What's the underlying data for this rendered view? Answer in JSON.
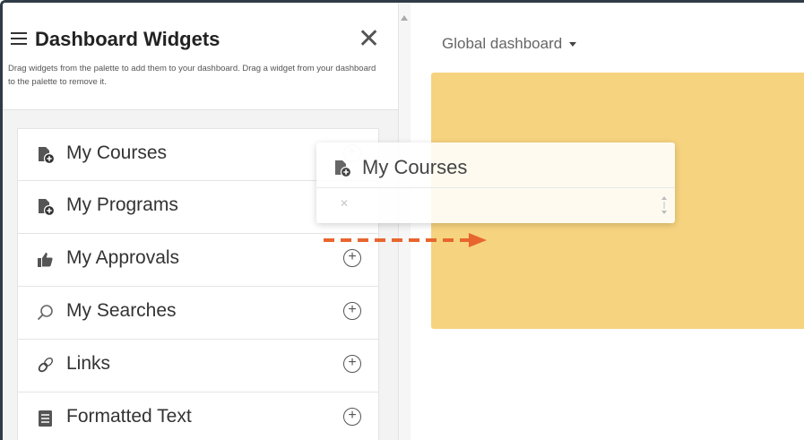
{
  "sidebar": {
    "title": "Dashboard Widgets",
    "description": "Drag widgets from the palette to add them to your dashboard. Drag a widget from your dashboard to the palette to remove it.",
    "close_symbol": "✕",
    "add_symbol": "+",
    "items": [
      {
        "label": "My Courses",
        "icon": "course-add-icon"
      },
      {
        "label": "My Programs",
        "icon": "program-add-icon"
      },
      {
        "label": "My Approvals",
        "icon": "thumbs-up-icon"
      },
      {
        "label": "My Searches",
        "icon": "search-icon"
      },
      {
        "label": "Links",
        "icon": "link-icon"
      },
      {
        "label": "Formatted Text",
        "icon": "document-icon"
      }
    ]
  },
  "main": {
    "dashboard_select": "Global dashboard",
    "canvas_color": "#f6d37f"
  },
  "drag_ghost": {
    "label": "My Courses",
    "close_symbol": "✕"
  },
  "colors": {
    "accent_arrow": "#e8662e",
    "frame": "#2f3b47"
  }
}
